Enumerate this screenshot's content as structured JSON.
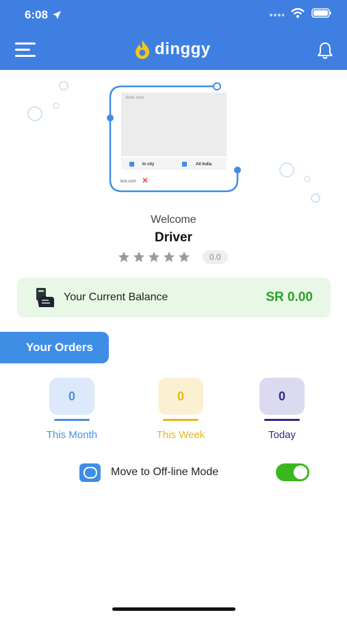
{
  "status_bar": {
    "time": "6:08"
  },
  "header": {
    "brand": "dinggy"
  },
  "illustration": {
    "textarea_placeholder": "Write here",
    "option_in_city": "In city",
    "option_all_india": "All India",
    "sample_text": "test.com"
  },
  "profile": {
    "welcome": "Welcome",
    "name": "Driver",
    "rating_value": "0.0",
    "stars_filled": 0,
    "stars_total": 5
  },
  "balance": {
    "label": "Your Current Balance",
    "value": "SR 0.00"
  },
  "orders": {
    "tab_label": "Your Orders",
    "stats": [
      {
        "label": "This Month",
        "value": "0",
        "color": "#4a90e2",
        "bg": "#dbe9fb"
      },
      {
        "label": "This Week",
        "value": "0",
        "color": "#e9b716",
        "bg": "#fbf1d2"
      },
      {
        "label": "Today",
        "value": "0",
        "color": "#2e2a86",
        "bg": "#dcdaf0"
      }
    ]
  },
  "offline_mode": {
    "label": "Move to Off-line Mode",
    "enabled": true
  },
  "colors": {
    "primary": "#3f7fe2",
    "success": "#27a428",
    "toggle": "#3ab71f"
  }
}
